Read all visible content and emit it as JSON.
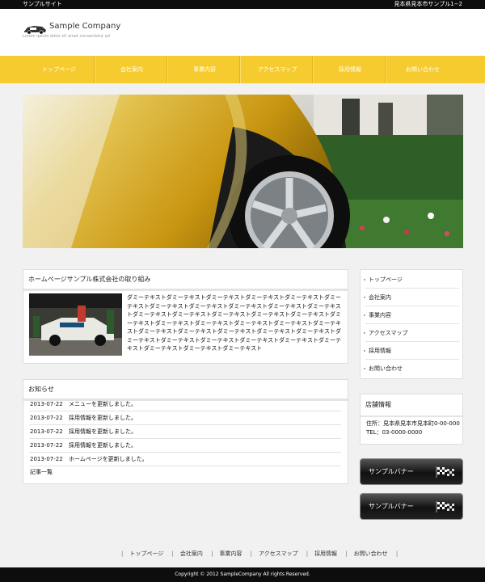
{
  "topbar": {
    "site_label": "サンプルサイト",
    "address_short": "見本県見本市サンプル1−2"
  },
  "header": {
    "company_name": "Sample Company",
    "tagline": "Lorem ipsum dolor sit amet consectetur ad"
  },
  "nav": {
    "items": [
      "トップページ",
      "会社案内",
      "事業内容",
      "アクセスマップ",
      "採用情報",
      "お問い合わせ"
    ]
  },
  "about": {
    "title": "ホームページサンプル株式会社の取り組み",
    "body": "ダミーテキストダミーテキストダミーテキストダミーテキストダミーテキストダミーテキストダミーテキストダミーテキストダミーテキストダミーテキストダミーテキストダミーテキストダミーテキストダミーテキストダミーテキストダミーテキストダミーテキストダミーテキストダミーテキストダミーテキストダミーテキストダミーテキストダミーテキストダミーテキストダミーテキストダミーテキストダミーテキストダミーテキストダミーテキストダミーテキストダミーテキストダミーテキストダミーテキストダミーテキストダミーテキストダミーテキスト"
  },
  "news": {
    "title": "お知らせ",
    "items": [
      {
        "date": "2013-07-22",
        "text": "メニューを更新しました。"
      },
      {
        "date": "2013-07-22",
        "text": "採用情報を更新しました。"
      },
      {
        "date": "2013-07-22",
        "text": "採用情報を更新しました。"
      },
      {
        "date": "2013-07-22",
        "text": "採用情報を更新しました。"
      },
      {
        "date": "2013-07-22",
        "text": "ホームページを更新しました。"
      }
    ],
    "more": "記事一覧"
  },
  "sidenav": {
    "items": [
      "トップページ",
      "会社案内",
      "事業内容",
      "アクセスマップ",
      "採用情報",
      "お問い合わせ"
    ]
  },
  "shop": {
    "title": "店舗情報",
    "address": "住所：見本県見本市見本町0-00-000",
    "tel": "TEL：03-0000-0000"
  },
  "banners": [
    {
      "label": "サンプルバナー"
    },
    {
      "label": "サンプルバナー"
    }
  ],
  "footer": {
    "links": [
      "トップページ",
      "会社案内",
      "事業内容",
      "アクセスマップ",
      "採用情報",
      "お問い合わせ"
    ],
    "copyright": "Copyright © 2012 SampleCompany All rights Reserved."
  },
  "colors": {
    "accent": "#f6cb2f",
    "dark": "#0d0d0d"
  },
  "icons": [
    "car-logo-icon",
    "checkered-flag-icon"
  ]
}
